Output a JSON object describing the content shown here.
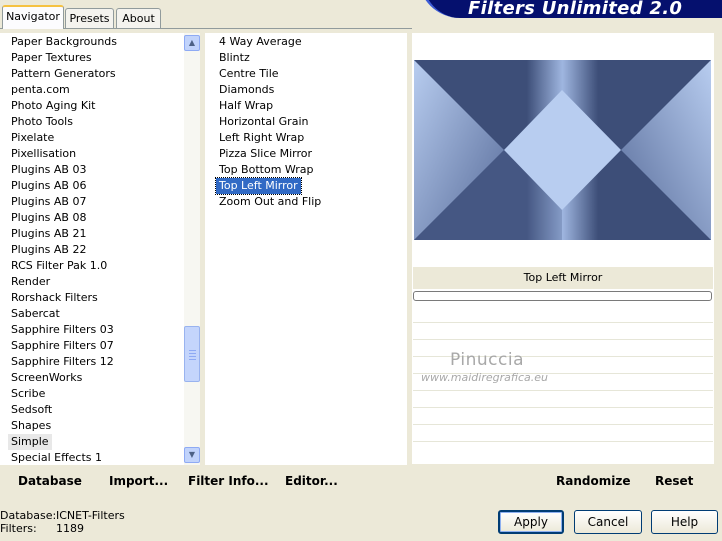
{
  "app": {
    "title": "Filters Unlimited 2.0"
  },
  "tabs": [
    {
      "label": "Navigator"
    },
    {
      "label": "Presets"
    },
    {
      "label": "About"
    }
  ],
  "categories": {
    "items": [
      "Paper Backgrounds",
      "Paper Textures",
      "Pattern Generators",
      "penta.com",
      "Photo Aging Kit",
      "Photo Tools",
      "Pixelate",
      "Pixellisation",
      "Plugins AB 03",
      "Plugins AB 06",
      "Plugins AB 07",
      "Plugins AB 08",
      "Plugins AB 21",
      "Plugins AB 22",
      "RCS Filter Pak 1.0",
      "Render",
      "Rorshack Filters",
      "Sabercat",
      "Sapphire Filters 03",
      "Sapphire Filters 07",
      "Sapphire Filters 12",
      "ScreenWorks",
      "Scribe",
      "Sedsoft",
      "Shapes",
      "Simple",
      "Special Effects 1"
    ],
    "selected": "Simple"
  },
  "filters": {
    "items": [
      "4 Way Average",
      "Blintz",
      "Centre Tile",
      "Diamonds",
      "Half Wrap",
      "Horizontal Grain",
      "Left Right Wrap",
      "Pizza Slice Mirror",
      "Top Bottom Wrap",
      "Top Left Mirror",
      "Zoom Out and Flip"
    ],
    "selected": "Top Left Mirror"
  },
  "preview": {
    "filter_name": "Top Left Mirror",
    "watermark_name": "Pinuccia",
    "watermark_url": "www.maidiregrafica.eu",
    "colors": {
      "dark": "#3d4e78",
      "light": "#b8cdf0"
    }
  },
  "toolbar": {
    "database": "Database",
    "import": "Import...",
    "filter_info": "Filter Info...",
    "editor": "Editor...",
    "randomize": "Randomize",
    "reset": "Reset"
  },
  "status": {
    "database_label": "Database:",
    "database_value": "ICNET-Filters",
    "filters_label": "Filters:",
    "filters_value": "1189"
  },
  "buttons": {
    "apply": "Apply",
    "cancel": "Cancel",
    "help": "Help"
  }
}
